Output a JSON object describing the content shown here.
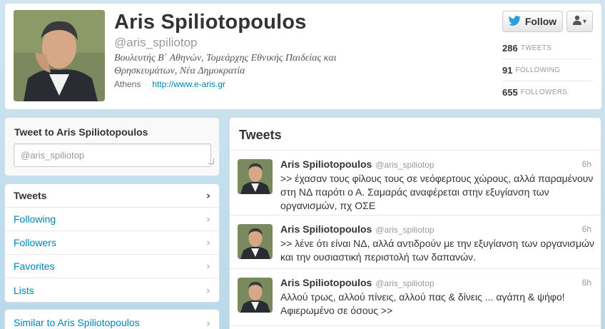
{
  "profile": {
    "name": "Aris Spiliotopoulos",
    "handle": "@aris_spiliotop",
    "bio": "Βουλευτής Β΄ Αθηνών, Τομεάρχης Εθνικής Παιδείας και Θρησκευμάτων, Νέα Δημοκρατία",
    "location": "Athens",
    "separator": "·",
    "url": "http://www.e-aris.gr"
  },
  "actions": {
    "follow_label": "Follow",
    "user_dropdown_caret": "▾"
  },
  "stats": [
    {
      "count": "286",
      "label": "TWEETS"
    },
    {
      "count": "91",
      "label": "FOLLOWING"
    },
    {
      "count": "655",
      "label": "FOLLOWERS"
    }
  ],
  "tweet_to": {
    "title": "Tweet to Aris Spiliotopoulos",
    "placeholder": "@aris_spiliotop"
  },
  "nav": {
    "items": [
      {
        "label": "Tweets",
        "active": true
      },
      {
        "label": "Following"
      },
      {
        "label": "Followers"
      },
      {
        "label": "Favorites"
      },
      {
        "label": "Lists"
      }
    ],
    "chevron": "›"
  },
  "similar": {
    "label": "Similar to Aris Spiliotopoulos"
  },
  "stream": {
    "title": "Tweets",
    "tweets": [
      {
        "name": "Aris Spiliotopoulos",
        "handle": "@aris_spiliotop",
        "time": "6h",
        "text": ">> έχασαν τους φίλους τους σε νεόφερτους χώρους, αλλά παραμένουν στη ΝΔ παρότι ο Α. Σαμαράς αναφέρεται στην εξυγίανση των οργανισμών, πχ ΟΣΕ"
      },
      {
        "name": "Aris Spiliotopoulos",
        "handle": "@aris_spiliotop",
        "time": "6h",
        "text": ">> λένε ότι είναι ΝΔ, αλλά αντιδρούν με την εξυγίανση των οργανισμών και την ουσιαστική περιστολή των δαπανών."
      },
      {
        "name": "Aris Spiliotopoulos",
        "handle": "@aris_spiliotop",
        "time": "6h",
        "text": "Αλλού τρως, αλλού πίνεις, αλλού πας & δίνεις ... αγάπη & ψήφο! Αφιερωμένο σε όσους >>"
      }
    ]
  },
  "colors": {
    "link": "#0084b4",
    "page_background": "#c0deed",
    "bird": "#2b9fd8"
  }
}
